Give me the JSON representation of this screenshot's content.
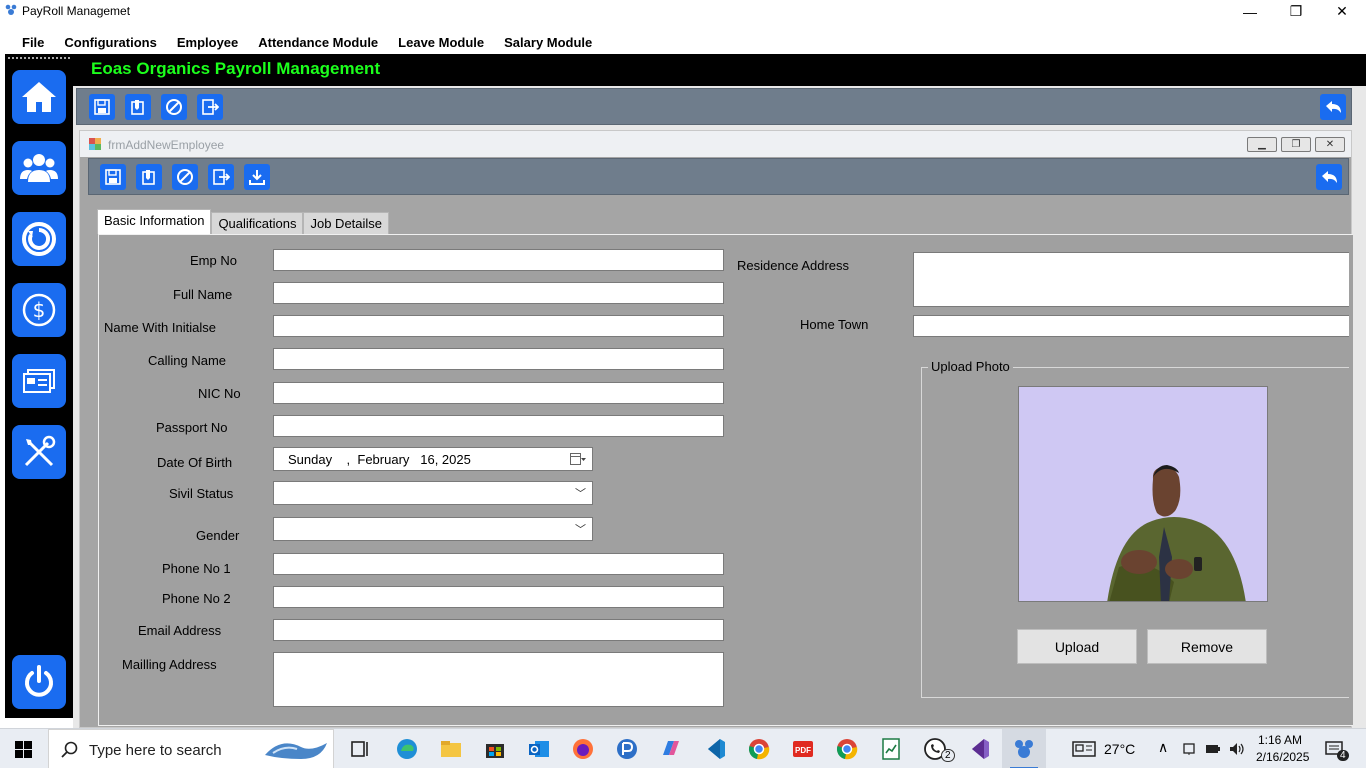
{
  "window": {
    "title": "PayRoll Managemet",
    "minimize": "—",
    "restore": "❐",
    "close": "✕"
  },
  "menu": [
    "File",
    "Configurations",
    "Employee",
    "Attendance Module",
    "Leave Module",
    "Salary Module"
  ],
  "header": {
    "company": "Eoas Organics Payroll Management"
  },
  "sidebar": {
    "items": [
      "home-icon",
      "employees-icon",
      "refresh-icon",
      "salary-icon",
      "cards-icon",
      "tools-icon",
      "power-icon"
    ]
  },
  "toolbar": {
    "buttons": [
      "save-icon",
      "edit-icon",
      "cancel-icon",
      "exit-icon"
    ],
    "back": "back-icon"
  },
  "child": {
    "title": "frmAddNewEmployee",
    "toolbar_buttons": [
      "save-icon",
      "edit-icon",
      "cancel-icon",
      "exit-icon",
      "download-icon"
    ]
  },
  "tabs": [
    "Basic Information",
    "Qualifications",
    "Job Detailse"
  ],
  "form": {
    "emp_no": "Emp No",
    "full_name": "Full Name",
    "name_initials": "Name With Initialse",
    "calling_name": "Calling Name",
    "nic_no": "NIC No",
    "passport_no": "Passport No",
    "dob": "Date Of Birth",
    "dob_value": "Sunday    ,  February   16, 2025",
    "civil_status": "Sivil Status",
    "gender": "Gender",
    "phone1": "Phone No 1",
    "phone2": "Phone No 2",
    "email": "Email Address",
    "mailing": "Mailling Address",
    "residence": "Residence Address",
    "home_town": "Home Town"
  },
  "photo": {
    "group_title": "Upload Photo",
    "upload": "Upload",
    "remove": "Remove"
  },
  "taskbar": {
    "search_placeholder": "Type here to search",
    "weather": "27°C",
    "time": "1:16 AM",
    "date": "2/16/2025",
    "notifications": "4",
    "whatsapp_badge": "2"
  }
}
